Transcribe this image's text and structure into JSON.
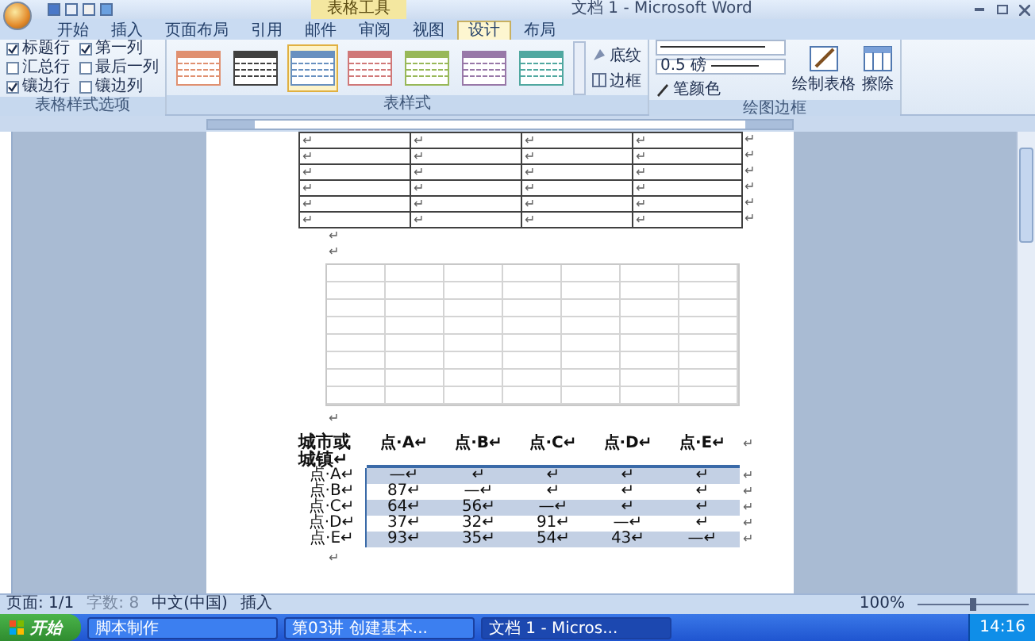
{
  "window": {
    "title": "文档 1 - Microsoft Word",
    "context_tab": "表格工具"
  },
  "tabs": [
    {
      "label": "开始",
      "selected": false
    },
    {
      "label": "插入",
      "selected": false
    },
    {
      "label": "页面布局",
      "selected": false
    },
    {
      "label": "引用",
      "selected": false
    },
    {
      "label": "邮件",
      "selected": false
    },
    {
      "label": "审阅",
      "selected": false
    },
    {
      "label": "视图",
      "selected": false
    },
    {
      "label": "设计",
      "selected": true
    },
    {
      "label": "布局",
      "selected": false
    }
  ],
  "style_options": {
    "label": "表格样式选项",
    "options": [
      {
        "label": "标题行",
        "checked": true
      },
      {
        "label": "第一列",
        "checked": true
      },
      {
        "label": "汇总行",
        "checked": false
      },
      {
        "label": "最后一列",
        "checked": false
      },
      {
        "label": "镶边行",
        "checked": true
      },
      {
        "label": "镶边列",
        "checked": false
      }
    ]
  },
  "table_styles": {
    "label": "表样式",
    "styles": [
      {
        "color": "#e09070",
        "selected": false
      },
      {
        "color": "#404040",
        "selected": false
      },
      {
        "color": "#6890c0",
        "selected": true
      },
      {
        "color": "#d07878",
        "selected": false
      },
      {
        "color": "#98b858",
        "selected": false
      },
      {
        "color": "#9878a8",
        "selected": false
      },
      {
        "color": "#50a8a0",
        "selected": false
      }
    ],
    "shading": "底纹",
    "borders": "边框"
  },
  "draw_borders": {
    "label": "绘图边框",
    "weight": "0.5 磅",
    "pen_color": "笔颜色",
    "draw_table": "绘制表格",
    "eraser": "擦除"
  },
  "document": {
    "table1": [
      {
        "cells": [
          "↵",
          "↵",
          "↵",
          "↵"
        ],
        "end": "↵"
      },
      {
        "cells": [
          "↵",
          "↵",
          "↵",
          "↵"
        ],
        "end": "↵"
      },
      {
        "cells": [
          "↵",
          "↵",
          "↵",
          "↵"
        ],
        "end": "↵"
      },
      {
        "cells": [
          "↵",
          "↵",
          "↵",
          "↵"
        ],
        "end": "↵"
      },
      {
        "cells": [
          "↵",
          "↵",
          "↵",
          "↵"
        ],
        "end": "↵"
      },
      {
        "cells": [
          "↵",
          "↵",
          "↵",
          "↵"
        ],
        "end": "↵"
      }
    ],
    "paragraphs_after_table1": [
      "↵",
      "↵"
    ],
    "paragraph_after_table2": "↵",
    "table3": {
      "corner": "城市或城镇↵",
      "headers": [
        "点·A↵",
        "点·B↵",
        "点·C↵",
        "点·D↵",
        "点·E↵"
      ],
      "header_end": "↵",
      "rows": [
        {
          "label": "点·A↵",
          "values": [
            "—↵",
            "↵",
            "↵",
            "↵",
            "↵"
          ],
          "end": "↵",
          "shaded": true
        },
        {
          "label": "点·B↵",
          "values": [
            "87↵",
            "—↵",
            "↵",
            "↵",
            "↵"
          ],
          "end": "↵",
          "shaded": false
        },
        {
          "label": "点·C↵",
          "values": [
            "64↵",
            "56↵",
            "—↵",
            "↵",
            "↵"
          ],
          "end": "↵",
          "shaded": true
        },
        {
          "label": "点·D↵",
          "values": [
            "37↵",
            "32↵",
            "91↵",
            "—↵",
            "↵"
          ],
          "end": "↵",
          "shaded": false
        },
        {
          "label": "点·E↵",
          "values": [
            "93↵",
            "35↵",
            "54↵",
            "43↵",
            "—↵"
          ],
          "end": "↵",
          "shaded": true
        }
      ]
    },
    "paragraph_after_table3": "↵"
  },
  "status_bar": {
    "page": "页面: 1/1",
    "words": "字数: 8",
    "language": "中文(中国)",
    "mode": "插入",
    "zoom": "100%",
    "zoom_slider": {
      "level": 0.5
    }
  },
  "taskbar": {
    "start": "开始",
    "items": [
      {
        "label": "脚本制作",
        "selected": false
      },
      {
        "label": "第03讲  创建基本...",
        "selected": false
      },
      {
        "label": "文档 1 - Micros...",
        "selected": true
      }
    ],
    "time": "14:16"
  }
}
